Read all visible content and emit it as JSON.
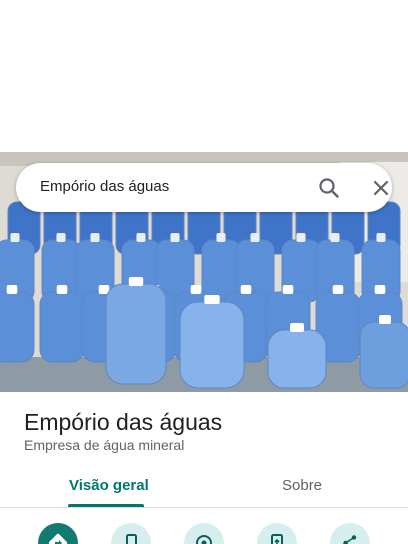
{
  "search": {
    "query": "Empório das águas"
  },
  "place": {
    "name": "Empório das águas",
    "category": "Empresa de água mineral"
  },
  "tabs": [
    {
      "label": "Visão geral",
      "active": true
    },
    {
      "label": "Sobre",
      "active": false
    }
  ],
  "colors": {
    "accent": "#00796b",
    "primary_action": "#137a72",
    "secondary_action": "#d6efee"
  },
  "actions": [
    {
      "icon": "directions-icon"
    },
    {
      "icon": "phone-icon"
    },
    {
      "icon": "nearby-icon"
    },
    {
      "icon": "send-to-phone-icon"
    },
    {
      "icon": "share-icon"
    }
  ]
}
